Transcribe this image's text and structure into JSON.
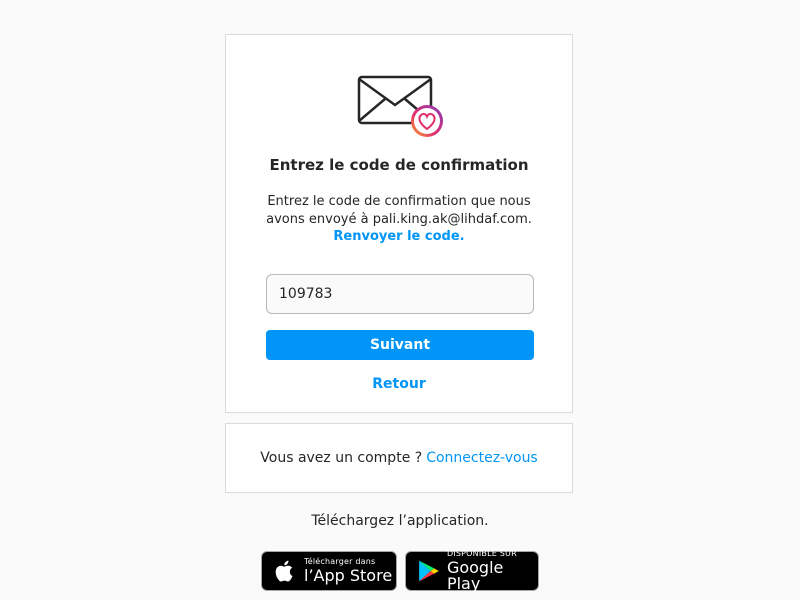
{
  "confirmation": {
    "title": "Entrez le code de confirmation",
    "description": "Entrez le code de confirmation que nous avons envoyé à pali.king.ak@lihdaf.com.",
    "resend_label": "Renvoyer le code.",
    "code_value": "109783",
    "next_label": "Suivant",
    "back_label": "Retour",
    "icons": {
      "mail": "envelope-icon",
      "badge": "heart-badge-icon"
    }
  },
  "login_prompt": {
    "text": "Vous avez un compte ?",
    "link_label": "Connectez-vous"
  },
  "app": {
    "label": "Téléchargez l’application.",
    "app_store": {
      "small": "Télécharger dans",
      "big": "l’App Store"
    },
    "google_play": {
      "small": "DISPONIBLE SUR",
      "big": "Google Play"
    }
  },
  "colors": {
    "accent": "#0095f6",
    "background": "#fafafa",
    "border": "#dbdbdb"
  }
}
